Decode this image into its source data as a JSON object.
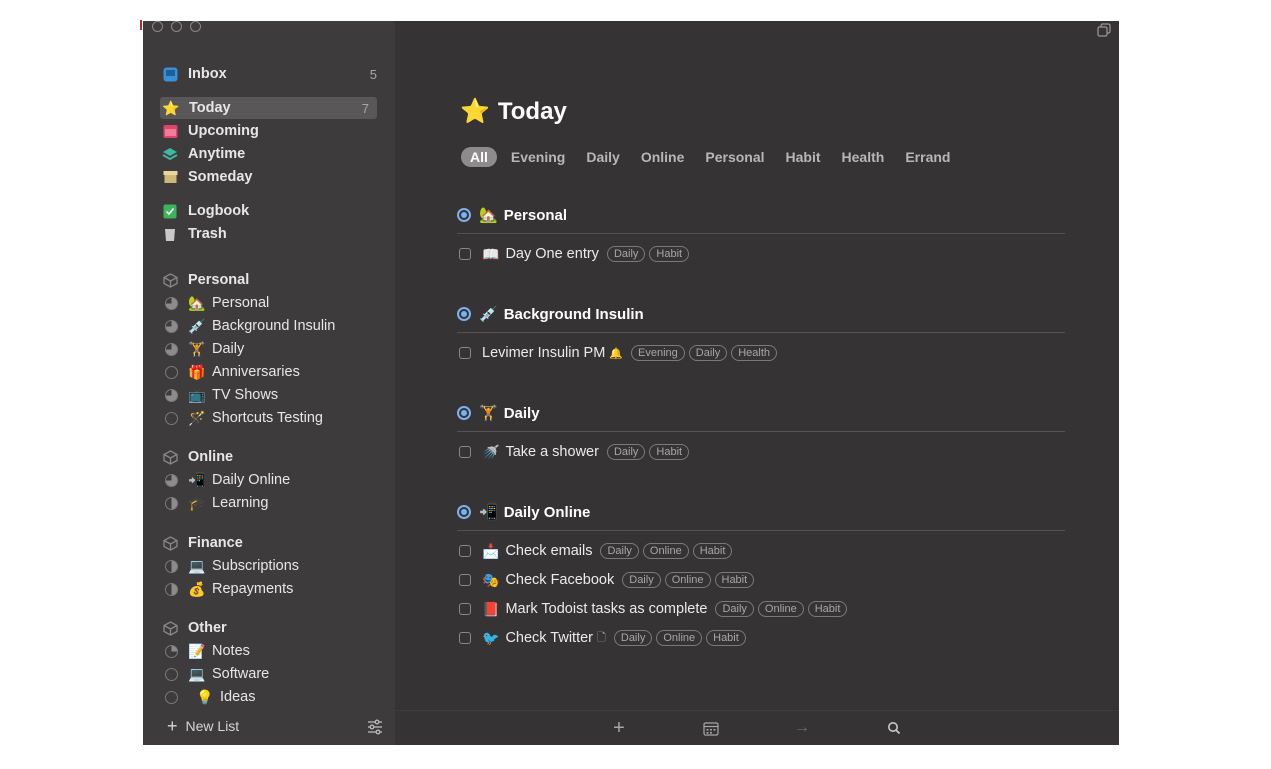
{
  "sidebar": {
    "inbox": {
      "label": "Inbox",
      "count": "5"
    },
    "today": {
      "label": "Today",
      "count": "7"
    },
    "upcoming": {
      "label": "Upcoming"
    },
    "anytime": {
      "label": "Anytime"
    },
    "someday": {
      "label": "Someday"
    },
    "logbook": {
      "label": "Logbook"
    },
    "trash": {
      "label": "Trash"
    },
    "areas": [
      {
        "label": "Personal",
        "projects": [
          {
            "emoji": "🏡",
            "label": "Personal",
            "progress": "fill"
          },
          {
            "emoji": "💉",
            "label": "Background Insulin",
            "progress": "fill"
          },
          {
            "emoji": "🏋️",
            "label": "Daily",
            "progress": "fill"
          },
          {
            "emoji": "🎁",
            "label": "Anniversaries",
            "progress": "none"
          },
          {
            "emoji": "📺",
            "label": "TV Shows",
            "progress": "fill"
          },
          {
            "emoji": "🪄",
            "label": "Shortcuts Testing",
            "progress": "none"
          }
        ]
      },
      {
        "label": "Online",
        "projects": [
          {
            "emoji": "📲",
            "label": "Daily Online",
            "progress": "fill"
          },
          {
            "emoji": "🎓",
            "label": "Learning",
            "progress": "half"
          }
        ]
      },
      {
        "label": "Finance",
        "projects": [
          {
            "emoji": "💻",
            "label": "Subscriptions",
            "progress": "half"
          },
          {
            "emoji": "💰",
            "label": "Repayments",
            "progress": "half"
          }
        ]
      },
      {
        "label": "Other",
        "projects": [
          {
            "emoji": "📝",
            "label": "Notes",
            "progress": "quar"
          },
          {
            "emoji": "💻",
            "label": "Software",
            "progress": "none"
          },
          {
            "emoji": "💡",
            "label": "Ideas",
            "progress": "none"
          }
        ]
      }
    ],
    "new_list": "New List"
  },
  "main": {
    "title": "Today",
    "filters": [
      "All",
      "Evening",
      "Daily",
      "Online",
      "Personal",
      "Habit",
      "Health",
      "Errand"
    ],
    "groups": [
      {
        "emoji": "🏡",
        "title": "Personal",
        "tasks": [
          {
            "emoji": "📖",
            "title": "Day One entry",
            "tags": [
              "Daily",
              "Habit"
            ]
          }
        ]
      },
      {
        "emoji": "💉",
        "title": "Background Insulin",
        "tasks": [
          {
            "emoji": "",
            "title": "Levimer Insulin PM",
            "tags": [
              "Evening",
              "Daily",
              "Health"
            ]
          }
        ]
      },
      {
        "emoji": "🏋️",
        "title": "Daily",
        "tasks": [
          {
            "emoji": "🚿",
            "title": "Take a shower",
            "tags": [
              "Daily",
              "Habit"
            ]
          }
        ]
      },
      {
        "emoji": "📲",
        "title": "Daily Online",
        "tasks": [
          {
            "emoji": "📩",
            "title": "Check emails",
            "tags": [
              "Daily",
              "Online",
              "Habit"
            ]
          },
          {
            "emoji": "🎭",
            "title": "Check Facebook",
            "tags": [
              "Daily",
              "Online",
              "Habit"
            ]
          },
          {
            "emoji": "📕",
            "title": "Mark Todoist tasks as complete",
            "tags": [
              "Daily",
              "Online",
              "Habit"
            ]
          },
          {
            "emoji": "🐦",
            "title": "Check Twitter",
            "tags": [
              "Daily",
              "Online",
              "Habit"
            ]
          }
        ]
      }
    ]
  }
}
